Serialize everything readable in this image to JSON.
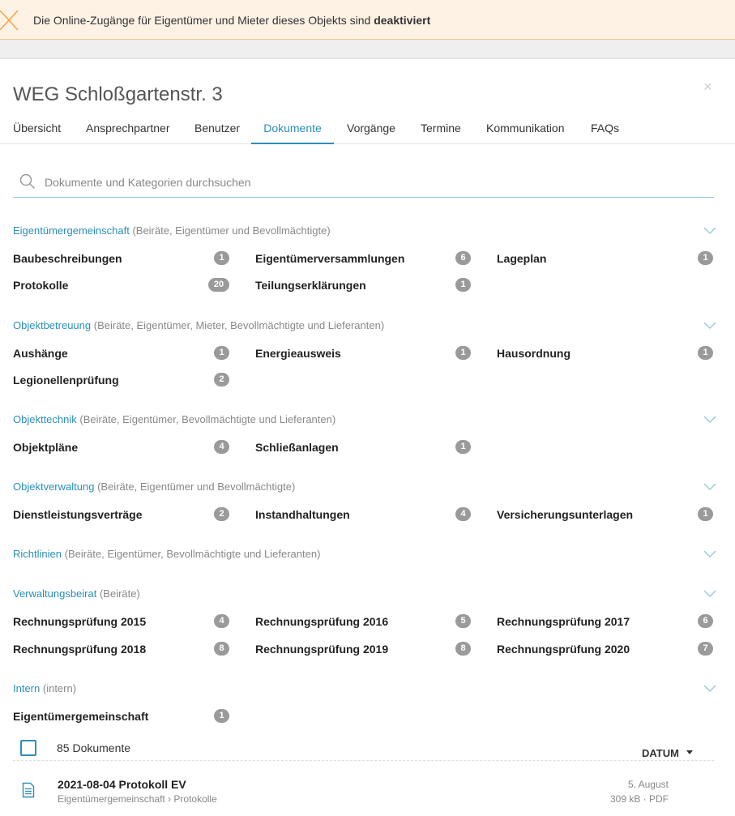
{
  "banner": {
    "text_prefix": "Die Online-Zugänge für Eigentümer und Mieter dieses Objekts sind",
    "text_bold": "deaktiviert",
    "icon": "close-x-icon",
    "color": "#f2a649"
  },
  "page": {
    "title": "WEG Schloßgartenstr. 3",
    "close_symbol": "×"
  },
  "tabs": [
    {
      "label": "Übersicht",
      "active": false
    },
    {
      "label": "Ansprechpartner",
      "active": false
    },
    {
      "label": "Benutzer",
      "active": false
    },
    {
      "label": "Dokumente",
      "active": true
    },
    {
      "label": "Vorgänge",
      "active": false
    },
    {
      "label": "Termine",
      "active": false
    },
    {
      "label": "Kommunikation",
      "active": false
    },
    {
      "label": "FAQs",
      "active": false
    }
  ],
  "search": {
    "placeholder": "Dokumente und Kategorien durchsuchen",
    "value": ""
  },
  "categories": [
    {
      "name": "Eigentümergemeinschaft",
      "audience": "(Beiräte, Eigentümer und Bevollmächtigte)",
      "items": [
        {
          "label": "Baubeschreibungen",
          "count": "1"
        },
        {
          "label": "Eigentümerversammlungen",
          "count": "6"
        },
        {
          "label": "Lageplan",
          "count": "1"
        },
        {
          "label": "Protokolle",
          "count": "20"
        },
        {
          "label": "Teilungserklärungen",
          "count": "1"
        }
      ]
    },
    {
      "name": "Objektbetreuung",
      "audience": "(Beiräte, Eigentümer, Mieter, Bevollmächtigte und Lieferanten)",
      "items": [
        {
          "label": "Aushänge",
          "count": "1"
        },
        {
          "label": "Energieausweis",
          "count": "1"
        },
        {
          "label": "Hausordnung",
          "count": "1"
        },
        {
          "label": "Legionellenprüfung",
          "count": "2"
        }
      ]
    },
    {
      "name": "Objekttechnik",
      "audience": "(Beiräte, Eigentümer, Bevollmächtigte und Lieferanten)",
      "items": [
        {
          "label": "Objektpläne",
          "count": "4"
        },
        {
          "label": "Schließanlagen",
          "count": "1"
        }
      ]
    },
    {
      "name": "Objektverwaltung",
      "audience": "(Beiräte, Eigentümer und Bevollmächtigte)",
      "items": [
        {
          "label": "Dienstleistungsverträge",
          "count": "2"
        },
        {
          "label": "Instandhaltungen",
          "count": "4"
        },
        {
          "label": "Versicherungsunterlagen",
          "count": "1"
        }
      ]
    },
    {
      "name": "Richtlinien",
      "audience": "(Beiräte, Eigentümer, Bevollmächtigte und Lieferanten)",
      "items": []
    },
    {
      "name": "Verwaltungsbeirat",
      "audience": "(Beiräte)",
      "items": [
        {
          "label": "Rechnungsprüfung 2015",
          "count": "4"
        },
        {
          "label": "Rechnungsprüfung 2016",
          "count": "5"
        },
        {
          "label": "Rechnungsprüfung 2017",
          "count": "6"
        },
        {
          "label": "Rechnungsprüfung 2018",
          "count": "8"
        },
        {
          "label": "Rechnungsprüfung 2019",
          "count": "8"
        },
        {
          "label": "Rechnungsprüfung 2020",
          "count": "7"
        }
      ]
    },
    {
      "name": "Intern",
      "audience": "(intern)",
      "items": [
        {
          "label": "Eigentümergemeinschaft",
          "count": "1"
        }
      ]
    }
  ],
  "documents": {
    "count_label": "85 Dokumente",
    "sort_label": "DATUM",
    "items": [
      {
        "title": "2021-08-04 Protokoll EV",
        "path": "Eigentümergemeinschaft › Protokolle",
        "date": "5. August",
        "meta": "309 kB · PDF",
        "icon": "document-icon"
      }
    ]
  },
  "colors": {
    "accent": "#2a8fb8",
    "badge": "#9a9a9a",
    "banner_bg": "#fdf2e4"
  }
}
